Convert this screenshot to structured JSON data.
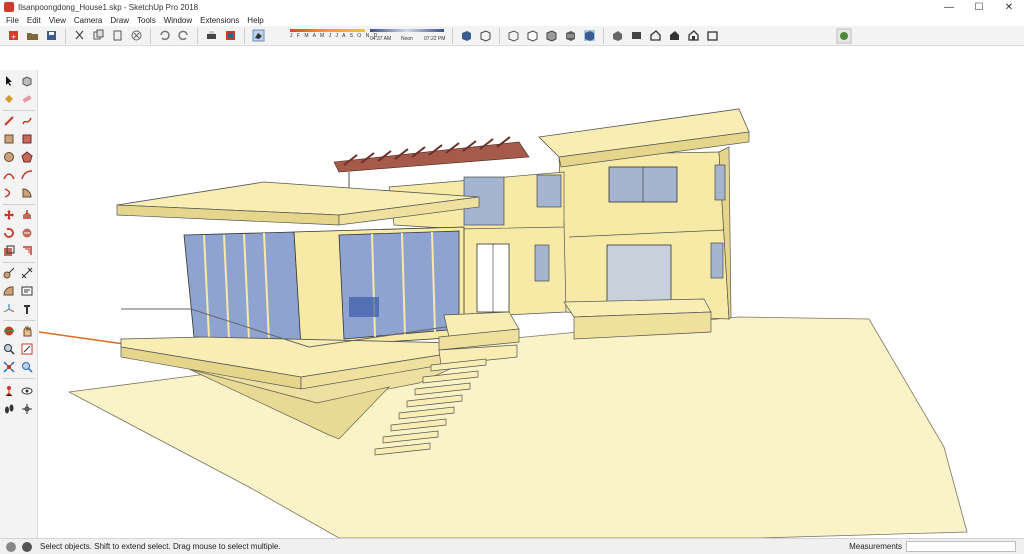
{
  "window": {
    "title": "Ilsanpoongdong_House1.skp - SketchUp Pro 2018",
    "controls": {
      "minimize": "—",
      "maximize": "☐",
      "close": "✕"
    }
  },
  "menu": [
    "File",
    "Edit",
    "View",
    "Camera",
    "Draw",
    "Tools",
    "Window",
    "Extensions",
    "Help"
  ],
  "toolbar": {
    "shadow": {
      "months": "J F M A M J J A S O N D",
      "time_start": "04:37 AM",
      "time_mid": "Noon",
      "time_end": "07:22 PM"
    },
    "icons": [
      "new-file-icon",
      "open-icon",
      "save-icon",
      "cut-icon",
      "copy-icon",
      "paste-icon",
      "erase-icon",
      "undo-icon",
      "redo-icon",
      "print-icon",
      "model-info-icon",
      "shadows-toggle-icon",
      "xray-icon",
      "back-edges-icon",
      "wireframe-icon",
      "hidden-line-icon",
      "shaded-icon",
      "shaded-textures-icon",
      "monochrome-icon",
      "iso-view-icon",
      "top-view-icon",
      "front-view-icon",
      "right-view-icon",
      "back-view-icon",
      "left-view-icon",
      "extension-warehouse-icon"
    ]
  },
  "colors": {
    "sky": "#ffffff",
    "ground": "#fbf3c8",
    "wall": "#f6eaa6",
    "wall_shade": "#e3d48a",
    "glass": "#8ea3cf",
    "pergola": "#a65a4a",
    "axis_red": "#e06820"
  },
  "status": {
    "message": "Select objects. Shift to extend select. Drag mouse to select multiple.",
    "measurements_label": "Measurements",
    "measurements_value": ""
  }
}
